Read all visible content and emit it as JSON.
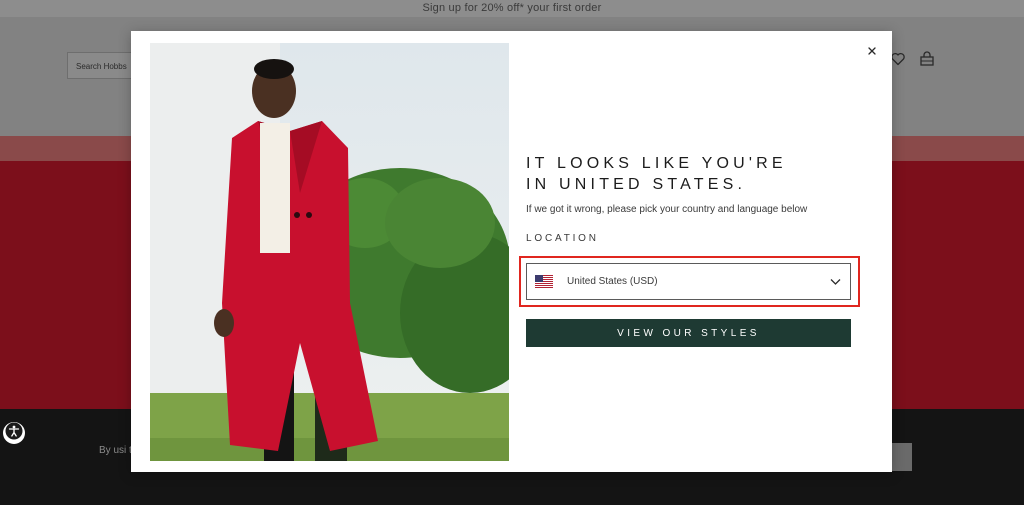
{
  "promo_bar": {
    "text": "Sign up for 20% off* your first order"
  },
  "header": {
    "search_placeholder": "Search Hobbs",
    "icons": [
      "heart-icon",
      "bag-icon"
    ]
  },
  "footer": {
    "cookie_text": "By usi the us"
  },
  "modal": {
    "heading_line1": "It looks like you're",
    "heading_line2": "in United States.",
    "subtext": "If we got it wrong, please pick your country and language below",
    "location_label": "LOCATION",
    "selected_country": "United States (USD)",
    "cta_label": "VIEW OUR STYLES",
    "close_icon": "close-icon",
    "flag_icon": "us-flag-icon"
  },
  "colors": {
    "overlay_page": "#7a7a7a",
    "hero_red": "#7c0f1b",
    "cta_green": "#1e3a33",
    "highlight_red": "#e0261f",
    "coat_red": "#c8102e"
  }
}
